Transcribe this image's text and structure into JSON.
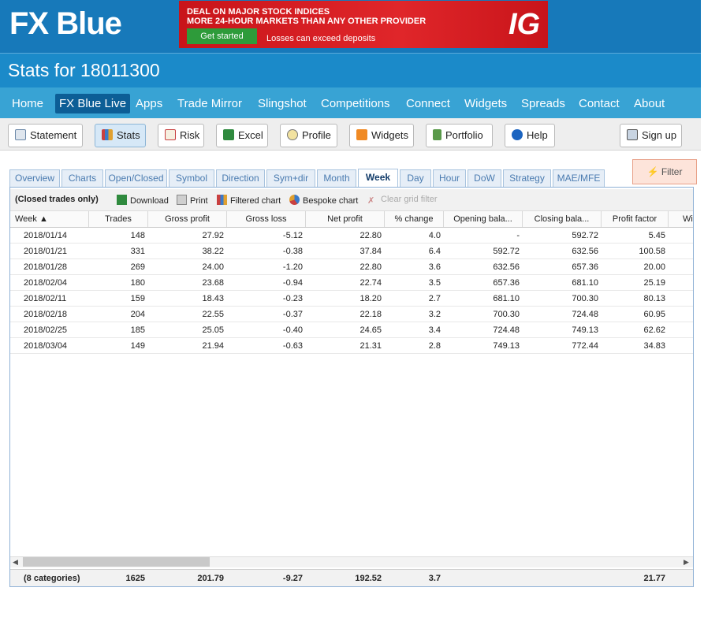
{
  "brand": {
    "logo": "FX Blue"
  },
  "banner": {
    "line1": "DEAL ON MAJOR STOCK INDICES",
    "line2": "MORE 24-HOUR MARKETS THAN ANY OTHER PROVIDER",
    "cta": "Get started",
    "disclaimer": "Losses can exceed deposits",
    "logo": "IG"
  },
  "page": {
    "title": "Stats for 18011300"
  },
  "nav": [
    "Home",
    "FX Blue Live",
    "Apps",
    "Trade Mirror",
    "Slingshot",
    "Competitions",
    "Connect",
    "Widgets",
    "Spreads",
    "Contact",
    "About"
  ],
  "toolbar": {
    "statement": "Statement",
    "stats": "Stats",
    "risk": "Risk",
    "excel": "Excel",
    "profile": "Profile",
    "widgets": "Widgets",
    "portfolio": "Portfolio",
    "help": "Help",
    "signup": "Sign up"
  },
  "tabs": [
    "Overview",
    "Charts",
    "Open/Closed",
    "Symbol",
    "Direction",
    "Sym+dir",
    "Month",
    "Week",
    "Day",
    "Hour",
    "DoW",
    "Strategy",
    "MAE/MFE"
  ],
  "filter_label": "Filter",
  "grid_toolbar": {
    "scope": "(Closed trades only)",
    "download": "Download",
    "print": "Print",
    "filtered_chart": "Filtered chart",
    "bespoke_chart": "Bespoke chart",
    "clear_filter": "Clear grid filter"
  },
  "columns": [
    "Week ▲",
    "Trades",
    "Gross profit",
    "Gross loss",
    "Net profit",
    "% change",
    "Opening bala...",
    "Closing bala...",
    "Profit factor",
    "Wi"
  ],
  "rows": [
    [
      "2018/01/14",
      "148",
      "27.92",
      "-5.12",
      "22.80",
      "4.0",
      "-",
      "592.72",
      "5.45"
    ],
    [
      "2018/01/21",
      "331",
      "38.22",
      "-0.38",
      "37.84",
      "6.4",
      "592.72",
      "632.56",
      "100.58"
    ],
    [
      "2018/01/28",
      "269",
      "24.00",
      "-1.20",
      "22.80",
      "3.6",
      "632.56",
      "657.36",
      "20.00"
    ],
    [
      "2018/02/04",
      "180",
      "23.68",
      "-0.94",
      "22.74",
      "3.5",
      "657.36",
      "681.10",
      "25.19"
    ],
    [
      "2018/02/11",
      "159",
      "18.43",
      "-0.23",
      "18.20",
      "2.7",
      "681.10",
      "700.30",
      "80.13"
    ],
    [
      "2018/02/18",
      "204",
      "22.55",
      "-0.37",
      "22.18",
      "3.2",
      "700.30",
      "724.48",
      "60.95"
    ],
    [
      "2018/02/25",
      "185",
      "25.05",
      "-0.40",
      "24.65",
      "3.4",
      "724.48",
      "749.13",
      "62.62"
    ],
    [
      "2018/03/04",
      "149",
      "21.94",
      "-0.63",
      "21.31",
      "2.8",
      "749.13",
      "772.44",
      "34.83"
    ]
  ],
  "footer": [
    "(8 categories)",
    "1625",
    "201.79",
    "-9.27",
    "192.52",
    "3.7",
    "",
    "",
    "21.77"
  ]
}
